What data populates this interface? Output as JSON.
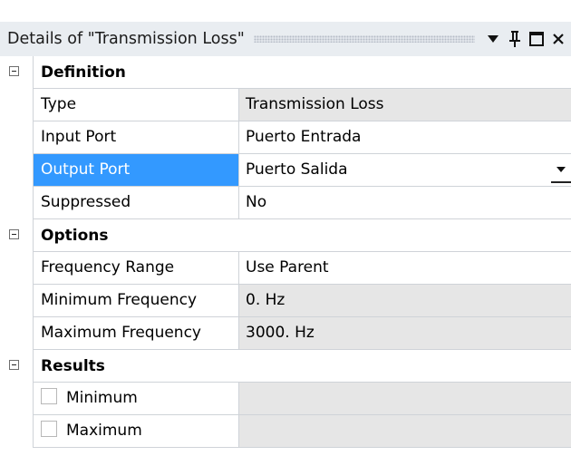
{
  "panel": {
    "title": "Details of \"Transmission Loss\"",
    "icons": [
      "dropdown-arrow-icon",
      "pin-icon",
      "maximize-icon",
      "close-icon"
    ]
  },
  "groups": [
    {
      "label": "Definition",
      "rows": [
        {
          "name": "Type",
          "value": "Transmission Loss",
          "readonly": true
        },
        {
          "name": "Input Port",
          "value": "Puerto Entrada",
          "readonly": false
        },
        {
          "name": "Output Port",
          "value": "Puerto Salida",
          "readonly": false,
          "selected": true,
          "dropdown": true
        },
        {
          "name": "Suppressed",
          "value": "No",
          "readonly": false
        }
      ]
    },
    {
      "label": "Options",
      "rows": [
        {
          "name": "Frequency Range",
          "value": "Use Parent",
          "readonly": false
        },
        {
          "name": "Minimum Frequency",
          "value": "0. Hz",
          "readonly": true
        },
        {
          "name": "Maximum Frequency",
          "value": "3000. Hz",
          "readonly": true
        }
      ]
    },
    {
      "label": "Results",
      "rows": [
        {
          "name": "Minimum",
          "value": "",
          "readonly": true,
          "checkbox": true
        },
        {
          "name": "Maximum",
          "value": "",
          "readonly": true,
          "checkbox": true
        }
      ]
    }
  ],
  "colors": {
    "selection": "#3399ff",
    "readonly_bg": "#e6e6e6",
    "titlebar_bg": "#e9edf1"
  }
}
